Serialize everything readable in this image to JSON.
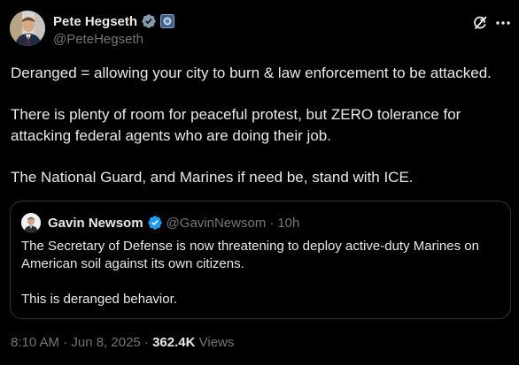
{
  "author": {
    "display_name": "Pete Hegseth",
    "handle": "@PeteHegseth",
    "verified_color": "#829aab",
    "badge": "gov-badge-icon"
  },
  "actions": {
    "grok_icon": "grok-icon",
    "more_icon": "more-icon"
  },
  "tweet": {
    "paragraphs": [
      "Deranged = allowing your city to burn & law enforcement to be attacked.",
      "There is plenty of room for peaceful protest, but ZERO tolerance for attacking federal agents who are doing their job.",
      "The National Guard, and Marines if need be, stand with ICE."
    ]
  },
  "quote": {
    "display_name": "Gavin Newsom",
    "handle": "@GavinNewsom",
    "separator": "·",
    "time": "10h",
    "verified_color": "#1d9bf0",
    "paragraphs": [
      "The Secretary of Defense is now threatening to deploy active-duty Marines on American soil against its own citizens.",
      "This is deranged behavior."
    ]
  },
  "meta": {
    "timestamp": "8:10 AM · Jun 8, 2025 · ",
    "views_count": "362.4K",
    "views_label": " Views"
  }
}
